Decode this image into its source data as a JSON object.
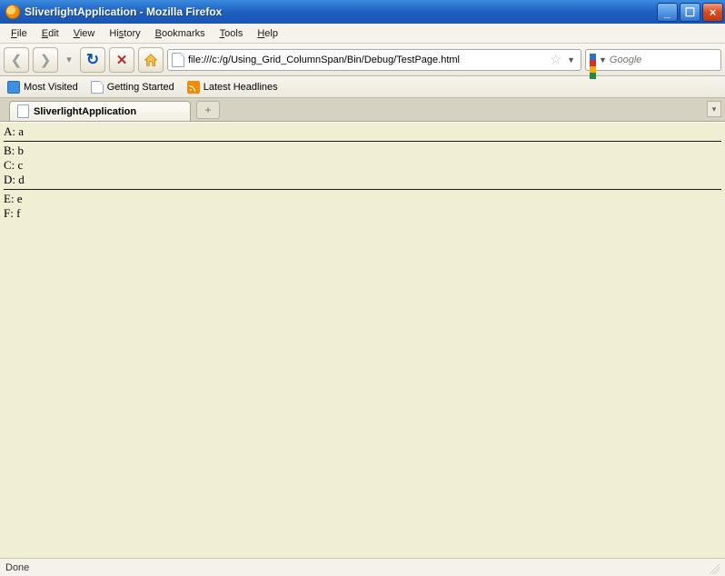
{
  "window": {
    "title": "SliverlightApplication - Mozilla Firefox"
  },
  "menu": {
    "file": "File",
    "edit": "Edit",
    "view": "View",
    "history": "History",
    "bookmarks": "Bookmarks",
    "tools": "Tools",
    "help": "Help"
  },
  "url": "file:///c:/g/Using_Grid_ColumnSpan/Bin/Debug/TestPage.html",
  "search": {
    "placeholder": "Google"
  },
  "bookmarks_bar": {
    "most_visited": "Most Visited",
    "getting_started": "Getting Started",
    "latest_headlines": "Latest Headlines"
  },
  "tab": {
    "title": "SliverlightApplication"
  },
  "page": {
    "rows": [
      "A: a",
      "B: b",
      "C: c",
      "D: d",
      "E: e",
      "F: f"
    ]
  },
  "status": {
    "text": "Done"
  }
}
